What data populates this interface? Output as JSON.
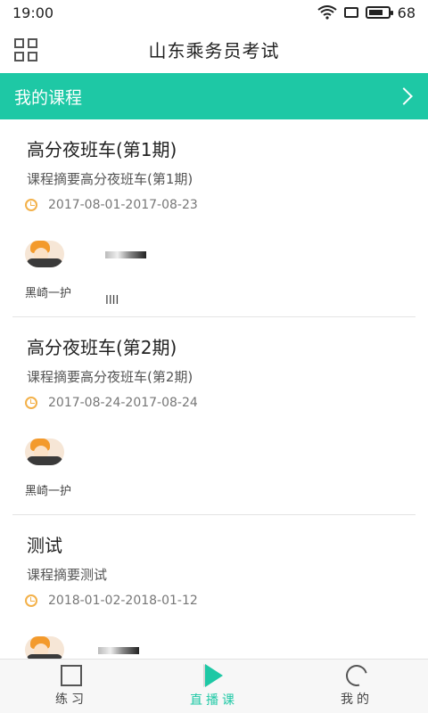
{
  "status_bar": {
    "time": "19:00",
    "battery_level": "68",
    "icons": [
      "wifi-icon",
      "sim-icon",
      "battery-icon"
    ]
  },
  "header": {
    "title": "山东乘务员考试",
    "menu_icon": "grid-menu-icon"
  },
  "section": {
    "title": "我的课程",
    "chevron_icon": "chevron-right-icon",
    "color": "#1ec8a5"
  },
  "courses": [
    {
      "title": "高分夜班车(第1期)",
      "summary": "课程摘要高分夜班车(第1期)",
      "date": "2017-08-01-2017-08-23",
      "teachers": [
        {
          "name": "黑崎一护"
        },
        {
          "name": "IIII"
        }
      ]
    },
    {
      "title": "高分夜班车(第2期)",
      "summary": "课程摘要高分夜班车(第2期)",
      "date": "2017-08-24-2017-08-24",
      "teachers": [
        {
          "name": "黑崎一护"
        }
      ]
    },
    {
      "title": "测试",
      "summary": "课程摘要测试",
      "date": "2018-01-02-2018-01-12",
      "teachers": [
        {
          "name": ""
        },
        {
          "name": ""
        }
      ]
    }
  ],
  "bottom_nav": {
    "items": [
      {
        "label": "练习",
        "icon": "practice-icon"
      },
      {
        "label": "直播课",
        "icon": "live-icon",
        "active": true
      },
      {
        "label": "我的",
        "icon": "profile-icon"
      }
    ],
    "active_color": "#1ec8a5"
  }
}
